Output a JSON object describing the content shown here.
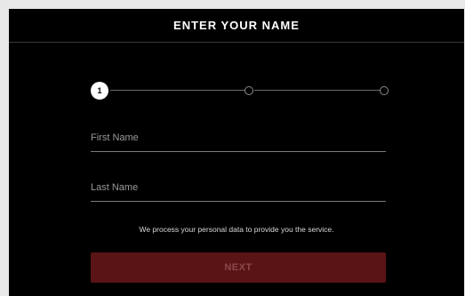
{
  "header": {
    "title": "ENTER YOUR NAME"
  },
  "stepper": {
    "current_step_label": "1",
    "steps": 3,
    "current": 1
  },
  "form": {
    "first_name": {
      "placeholder": "First Name",
      "value": ""
    },
    "last_name": {
      "placeholder": "Last Name",
      "value": ""
    },
    "notice": "We process your personal data to provide you the service.",
    "next_label": "NEXT"
  },
  "colors": {
    "background": "#000000",
    "button": "#5a1416",
    "button_text": "#8a4a4c"
  }
}
